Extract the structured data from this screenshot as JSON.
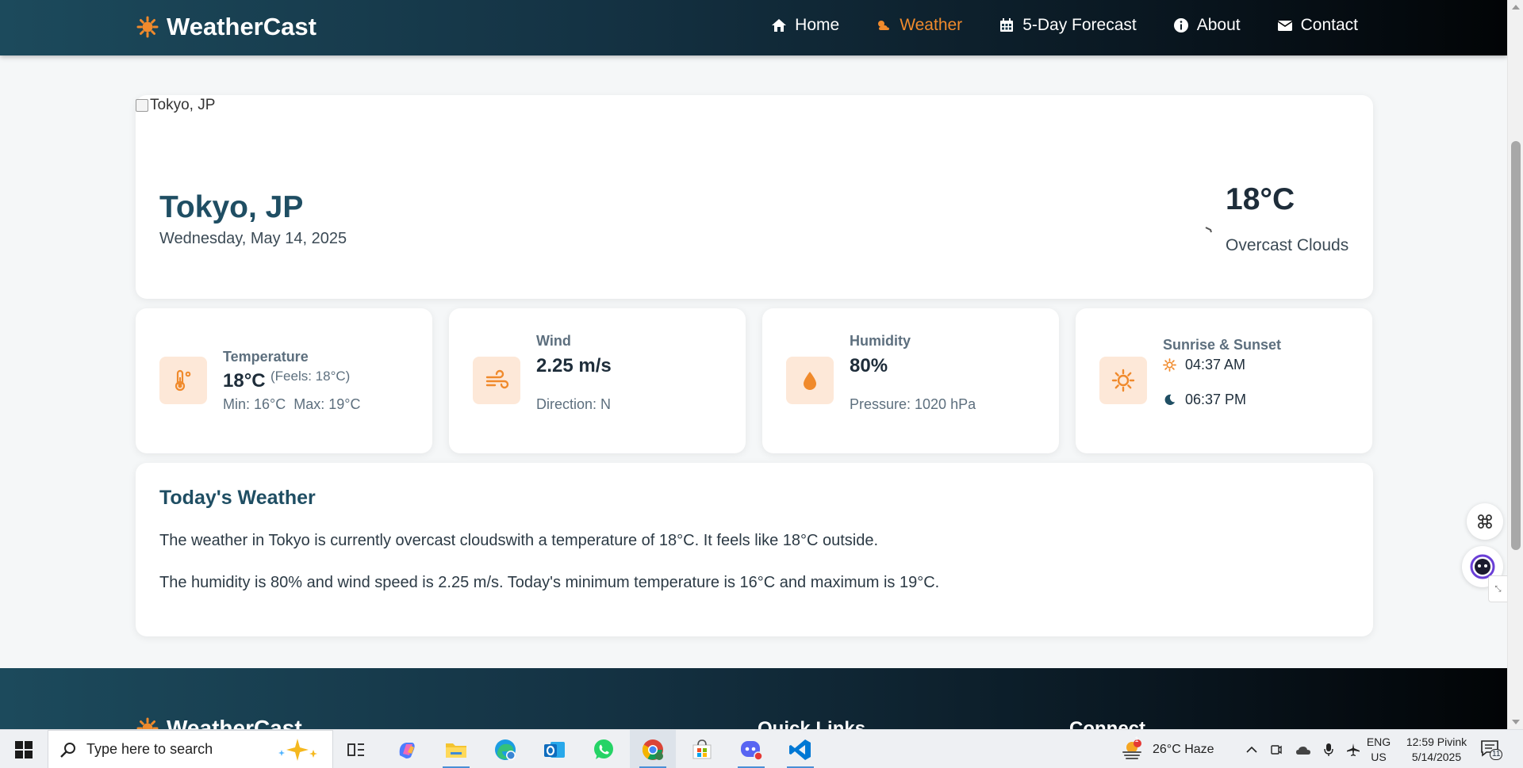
{
  "header": {
    "brand": "WeatherCast",
    "nav": [
      {
        "label": "Home",
        "icon": "home-icon"
      },
      {
        "label": "Weather",
        "icon": "cloud-sun-icon",
        "active": true
      },
      {
        "label": "5-Day Forecast",
        "icon": "calendar-icon"
      },
      {
        "label": "About",
        "icon": "info-icon"
      },
      {
        "label": "Contact",
        "icon": "envelope-icon"
      }
    ]
  },
  "hero": {
    "image_alt": "Tokyo, JP",
    "city": "Tokyo, JP",
    "date": "Wednesday, May 14, 2025",
    "temperature": "18°C",
    "condition": "Overcast Clouds"
  },
  "stats": {
    "temperature": {
      "title": "Temperature",
      "value": "18°C",
      "feels": "(Feels: 18°C)",
      "minmax": "Min: 16°C  Max: 19°C"
    },
    "wind": {
      "title": "Wind",
      "value": "2.25 m/s",
      "direction": "Direction: N"
    },
    "humidity": {
      "title": "Humidity",
      "value": "80%",
      "pressure": "Pressure: 1020 hPa"
    },
    "sun": {
      "title": "Sunrise & Sunset",
      "sunrise": "04:37 AM",
      "sunset": "06:37 PM"
    }
  },
  "today": {
    "heading": "Today's Weather",
    "para1": "The weather in Tokyo is currently overcast cloudswith a temperature of 18°C. It feels like 18°C outside.",
    "para2": "The humidity is 80% and wind speed is 2.25 m/s. Today's minimum temperature is 16°C and maximum is 19°C."
  },
  "footer": {
    "brand": "WeatherCast",
    "quick_links": "Quick Links",
    "connect": "Connect"
  },
  "taskbar": {
    "search_placeholder": "Type here to search",
    "weather": "26°C  Haze",
    "weather_badge": "1",
    "lang1": "ENG",
    "lang2": "US",
    "time": "12:59 Pivink",
    "date": "5/14/2025",
    "notif_count": "11"
  },
  "colors": {
    "accent": "#f08a2c",
    "heading": "#1f4e63",
    "icon_bg": "#fde8d8"
  }
}
